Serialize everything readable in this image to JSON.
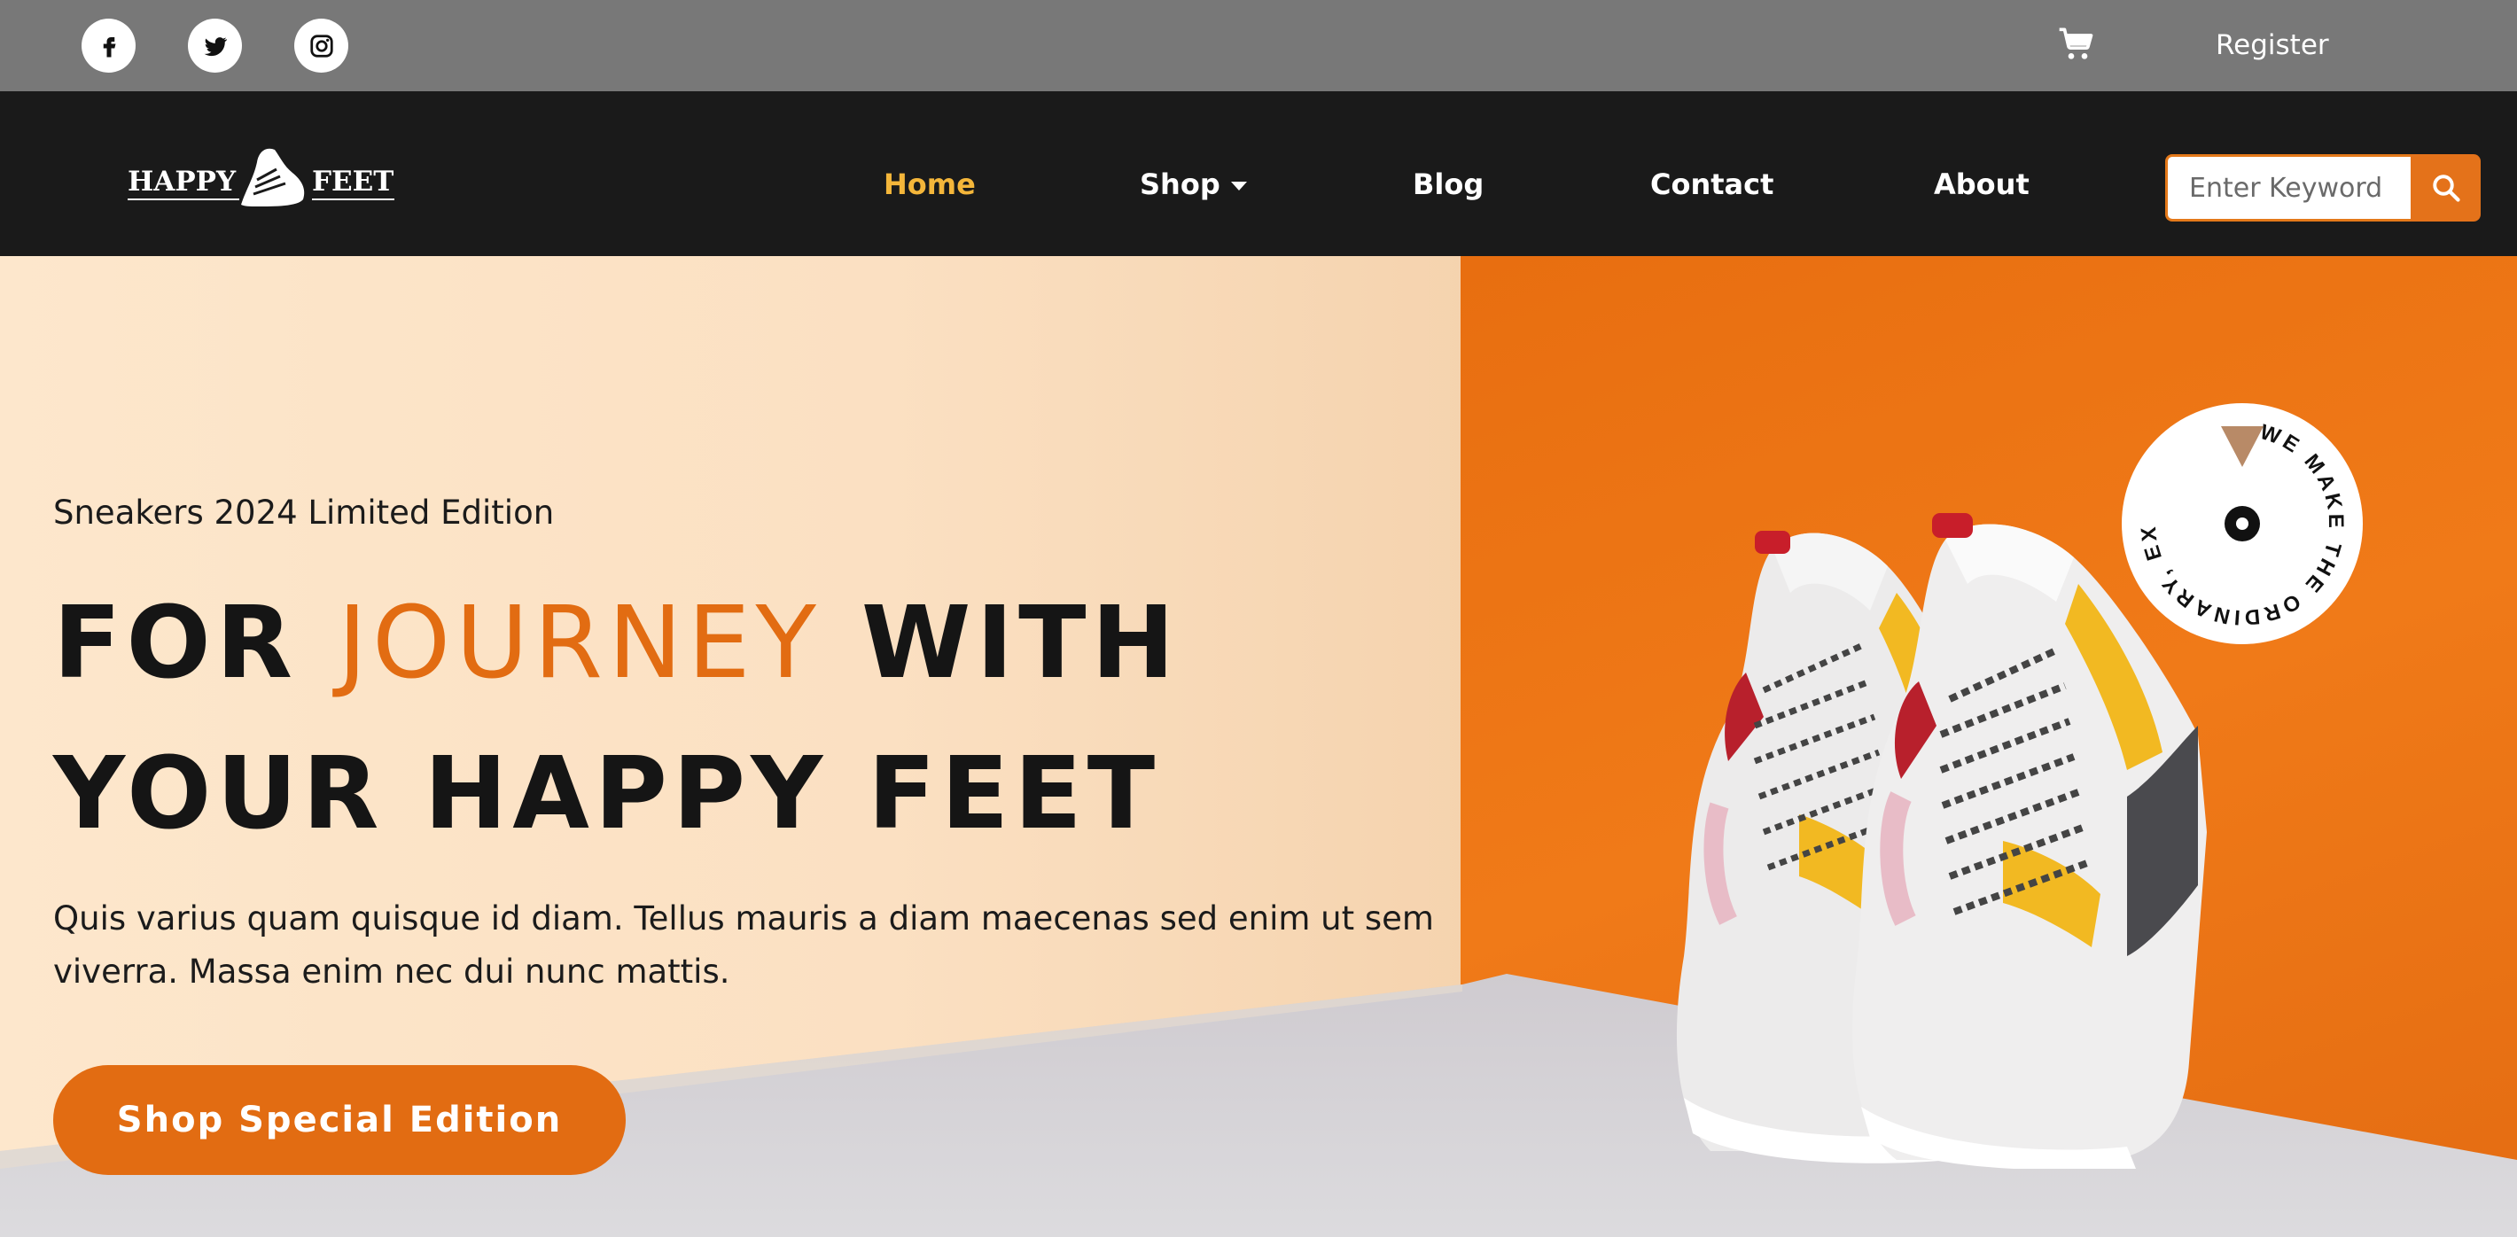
{
  "topbar": {
    "social": [
      {
        "name": "facebook-icon",
        "label": "f"
      },
      {
        "name": "twitter-icon",
        "label": ""
      },
      {
        "name": "instagram-icon",
        "label": ""
      }
    ],
    "cart_icon": "cart-icon",
    "register_label": "Register"
  },
  "navbar": {
    "logo_left": "HAPPY",
    "logo_right": "FEET",
    "items": [
      {
        "label": "Home",
        "active": true
      },
      {
        "label": "Shop",
        "dropdown": true
      },
      {
        "label": "Blog"
      },
      {
        "label": "Contact"
      },
      {
        "label": "About"
      }
    ],
    "search": {
      "placeholder": "Enter Keyword",
      "value": ""
    }
  },
  "hero": {
    "eyebrow": "Sneakers 2024 Limited Edition",
    "headline_part1": "FOR ",
    "headline_accent": "JOURNEY",
    "headline_part2": " WITH",
    "headline_line2": "YOUR HAPPY FEET",
    "lead": "Quis varius quam quisque id diam. Tellus mauris a diam maecenas sed enim ut sem viverra. Massa enim nec dui nunc mattis.",
    "cta_label": "Shop Special Edition",
    "badge_text": "WE MAKE THE ORDINARY, EXTRAORDINARY."
  },
  "colors": {
    "accent": "#e26c12",
    "active_nav": "#f4b63a",
    "topbar": "#787878",
    "navbar": "#1a1a1a"
  }
}
